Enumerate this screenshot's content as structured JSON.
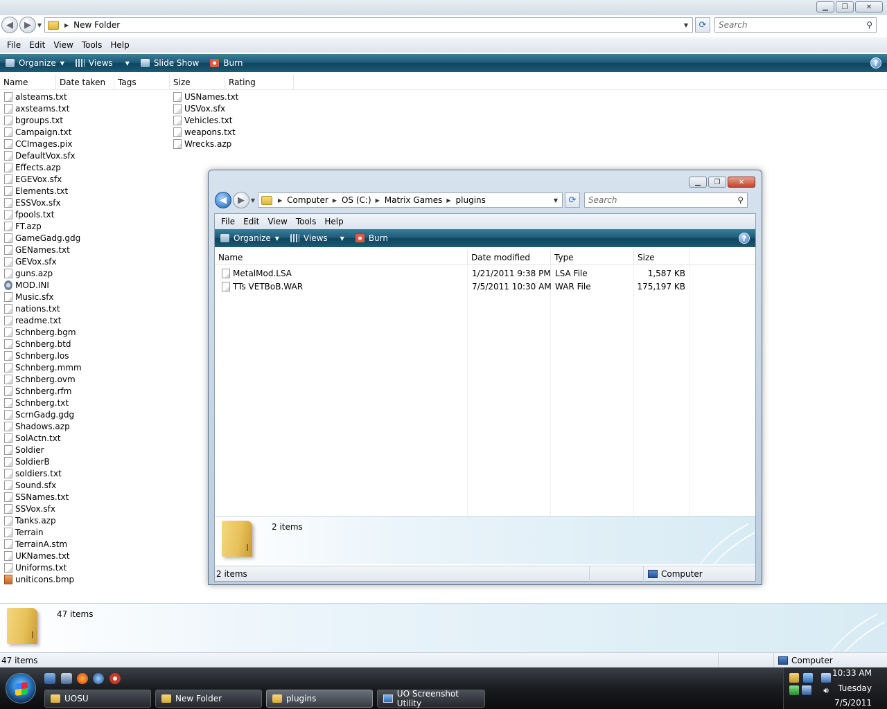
{
  "main_window": {
    "address": {
      "crumbs": [
        "New Folder"
      ]
    },
    "search_placeholder": "Search",
    "menu": [
      "File",
      "Edit",
      "View",
      "Tools",
      "Help"
    ],
    "commands": {
      "organize": "Organize",
      "views": "Views",
      "slideshow": "Slide Show",
      "burn": "Burn"
    },
    "columns": [
      "Name",
      "Date taken",
      "Tags",
      "Size",
      "Rating"
    ],
    "files_col1": [
      "alsteams.txt",
      "axsteams.txt",
      "bgroups.txt",
      "Campaign.txt",
      "CCImages.pix",
      "DefaultVox.sfx",
      "Effects.azp",
      "EGEVox.sfx",
      "Elements.txt",
      "ESSVox.sfx",
      "fpools.txt",
      "FT.azp",
      "GameGadg.gdg",
      "GENames.txt",
      "GEVox.sfx",
      "guns.azp",
      "MOD.INI",
      "Music.sfx",
      "nations.txt",
      "readme.txt",
      "Schnberg.bgm",
      "Schnberg.btd",
      "Schnberg.los",
      "Schnberg.mmm",
      "Schnberg.ovm",
      "Schnberg.rfm",
      "Schnberg.txt",
      "ScrnGadg.gdg",
      "Shadows.azp",
      "SolActn.txt",
      "Soldier",
      "SoldierB",
      "soldiers.txt",
      "Sound.sfx",
      "SSNames.txt",
      "SSVox.sfx",
      "Tanks.azp",
      "Terrain",
      "TerrainA.stm",
      "UKNames.txt",
      "Uniforms.txt",
      "uniticons.bmp"
    ],
    "files_col2": [
      "USNames.txt",
      "USVox.sfx",
      "Vehicles.txt",
      "weapons.txt",
      "Wrecks.azp"
    ],
    "details_count": "47 items",
    "status_count": "47 items",
    "status_location": "Computer"
  },
  "plugins_window": {
    "address": {
      "crumbs": [
        "Computer",
        "OS (C:)",
        "Matrix Games",
        "plugins"
      ]
    },
    "search_placeholder": "Search",
    "menu": [
      "File",
      "Edit",
      "View",
      "Tools",
      "Help"
    ],
    "commands": {
      "organize": "Organize",
      "views": "Views",
      "burn": "Burn"
    },
    "columns": [
      "Name",
      "Date modified",
      "Type",
      "Size"
    ],
    "files": [
      {
        "name": "MetalMod.LSA",
        "date": "1/21/2011 9:38 PM",
        "type": "LSA File",
        "size": "1,587 KB"
      },
      {
        "name": "TTs VETBoB.WAR",
        "date": "7/5/2011 10:30 AM",
        "type": "WAR File",
        "size": "175,197 KB"
      }
    ],
    "details_count": "2 items",
    "status_count": "2 items",
    "status_location": "Computer"
  },
  "taskbar": {
    "tasks": [
      "UOSU",
      "New Folder",
      "plugins",
      "UO Screenshot Utility"
    ],
    "clock": {
      "time": "10:33 AM",
      "day": "Tuesday",
      "date": "7/5/2011"
    }
  },
  "colors": {
    "command_bar": "#1d5a77",
    "accent": "#2b6fb8"
  }
}
